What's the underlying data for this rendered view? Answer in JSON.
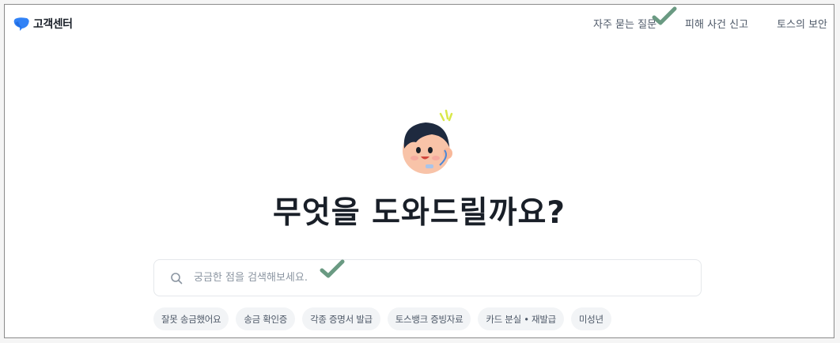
{
  "brand": {
    "logo_text": "고객센터",
    "accent": "#3182f6"
  },
  "nav": {
    "items": [
      {
        "label": "자주 묻는 질문"
      },
      {
        "label": "피해 사건 신고"
      },
      {
        "label": "토스의 보안"
      }
    ]
  },
  "main": {
    "headline": "무엇을 도와드릴까요?",
    "search": {
      "placeholder": "궁금한 점을 검색해보세요.",
      "value": ""
    },
    "chips": [
      {
        "label": "잘못 송금했어요"
      },
      {
        "label": "송금 확인증"
      },
      {
        "label": "각종 증명서 발급"
      },
      {
        "label": "토스뱅크 증빙자료"
      },
      {
        "label": "카드 분실 • 재발급"
      },
      {
        "label": "미성년"
      }
    ]
  },
  "overlay": {
    "check_color": "#6a9a82"
  }
}
